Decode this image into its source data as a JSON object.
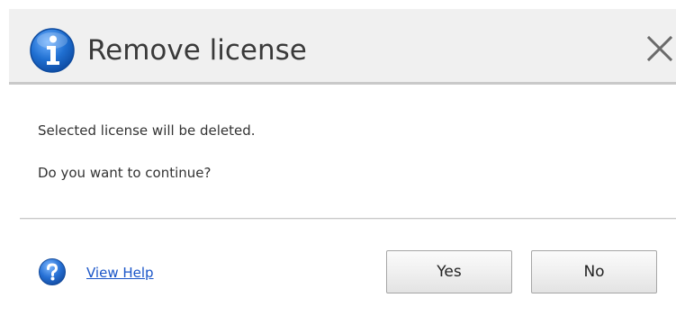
{
  "dialog": {
    "title": "Remove license",
    "title_icon": "info-icon",
    "close_icon": "close-icon",
    "message_line1": "Selected license will be deleted.",
    "message_line2": "Do you want to continue?"
  },
  "footer": {
    "help_icon": "help-icon",
    "help_link_label": "View Help",
    "yes_label": "Yes",
    "no_label": "No"
  },
  "colors": {
    "info_icon_blue": "#1f6fd1",
    "link_blue": "#1a55c8",
    "titlebar_bg": "#f0f0f0"
  }
}
